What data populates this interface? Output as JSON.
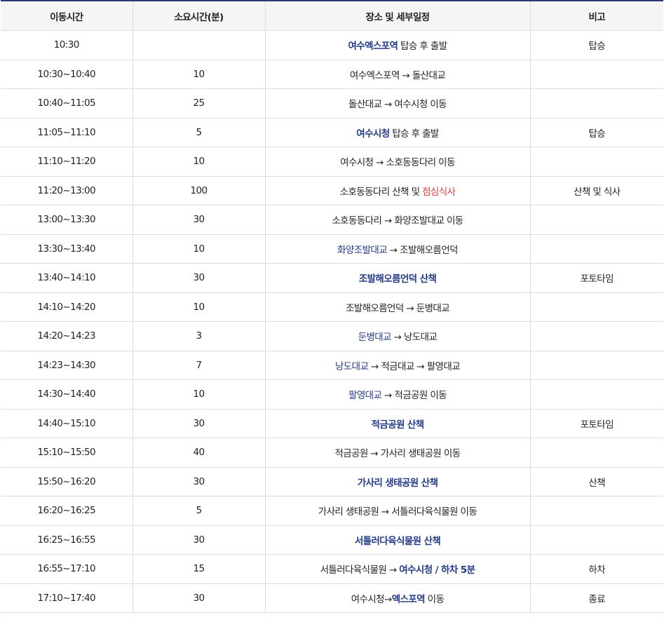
{
  "headers": [
    "이동시간",
    "소요시간(분)",
    "장소 및 세부일정",
    "비고"
  ],
  "rows": [
    {
      "time": "10:30",
      "dur": "",
      "detail": [
        {
          "t": "여수엑스포역",
          "s": "hl b"
        },
        {
          "t": " 탑승 후 출발"
        }
      ],
      "note": "탑승"
    },
    {
      "time": "10:30~10:40",
      "dur": "10",
      "detail": [
        {
          "t": "여수엑스포역 → 돌산대교"
        }
      ],
      "note": ""
    },
    {
      "time": "10:40~11:05",
      "dur": "25",
      "detail": [
        {
          "t": "돌산대교 → 여수시청 이동"
        }
      ],
      "note": ""
    },
    {
      "time": "11:05~11:10",
      "dur": "5",
      "detail": [
        {
          "t": "여수시청",
          "s": "hl b"
        },
        {
          "t": " 탑승 후 출발"
        }
      ],
      "note": "탑승"
    },
    {
      "time": "11:10~11:20",
      "dur": "10",
      "detail": [
        {
          "t": "여수시청 → 소호동동다리 이동"
        }
      ],
      "note": ""
    },
    {
      "time": "11:20~13:00",
      "dur": "100",
      "detail": [
        {
          "t": "소호동동다리 산책 및 "
        },
        {
          "t": "점심식사",
          "s": "red"
        }
      ],
      "note": "산책 및 식사"
    },
    {
      "time": "13:00~13:30",
      "dur": "30",
      "detail": [
        {
          "t": "소호동동다리 → 화양조발대교 이동"
        }
      ],
      "note": ""
    },
    {
      "time": "13:30~13:40",
      "dur": "10",
      "detail": [
        {
          "t": "화양조발대교",
          "s": "hl"
        },
        {
          "t": " → 조발해오름언덕"
        }
      ],
      "note": ""
    },
    {
      "time": "13:40~14:10",
      "dur": "30",
      "detail": [
        {
          "t": "조발해오름언덕 산책",
          "s": "hl b"
        }
      ],
      "note": "포토타임"
    },
    {
      "time": "14:10~14:20",
      "dur": "10",
      "detail": [
        {
          "t": "조발해오름언덕 → 둔병대교"
        }
      ],
      "note": ""
    },
    {
      "time": "14:20~14:23",
      "dur": "3",
      "detail": [
        {
          "t": "둔병대교",
          "s": "hl"
        },
        {
          "t": " → 낭도대교"
        }
      ],
      "note": ""
    },
    {
      "time": "14:23~14:30",
      "dur": "7",
      "detail": [
        {
          "t": "낭도대교",
          "s": "hl"
        },
        {
          "t": " → 적금대교 → 팔영대교"
        }
      ],
      "note": ""
    },
    {
      "time": "14:30~14:40",
      "dur": "10",
      "detail": [
        {
          "t": "팔영대교",
          "s": "hl"
        },
        {
          "t": " → 적금공원 이동"
        }
      ],
      "note": ""
    },
    {
      "time": "14:40~15:10",
      "dur": "30",
      "detail": [
        {
          "t": "적금공원 산책",
          "s": "hl b"
        }
      ],
      "note": "포토타임"
    },
    {
      "time": "15:10~15:50",
      "dur": "40",
      "detail": [
        {
          "t": "적금공원 → 가사리 생태공원 이동"
        }
      ],
      "note": ""
    },
    {
      "time": "15:50~16:20",
      "dur": "30",
      "detail": [
        {
          "t": "가사리 생태공원 산책",
          "s": "hl b"
        }
      ],
      "note": "산책"
    },
    {
      "time": "16:20~16:25",
      "dur": "5",
      "detail": [
        {
          "t": "가사리 생태공원 → 서틀러다육식물원 이동"
        }
      ],
      "note": ""
    },
    {
      "time": "16:25~16:55",
      "dur": "30",
      "detail": [
        {
          "t": "서틀러다육식물원 산책",
          "s": "hl b"
        }
      ],
      "note": ""
    },
    {
      "time": "16:55~17:10",
      "dur": "15",
      "detail": [
        {
          "t": "서틀러다육식물원 → "
        },
        {
          "t": "여수시청 / 하차 5분",
          "s": "hl b"
        }
      ],
      "note": "하차"
    },
    {
      "time": "17:10~17:40",
      "dur": "30",
      "detail": [
        {
          "t": "여수시청→"
        },
        {
          "t": "엑스포역",
          "s": "hl b"
        },
        {
          "t": " 이동"
        }
      ],
      "note": "종료"
    }
  ]
}
